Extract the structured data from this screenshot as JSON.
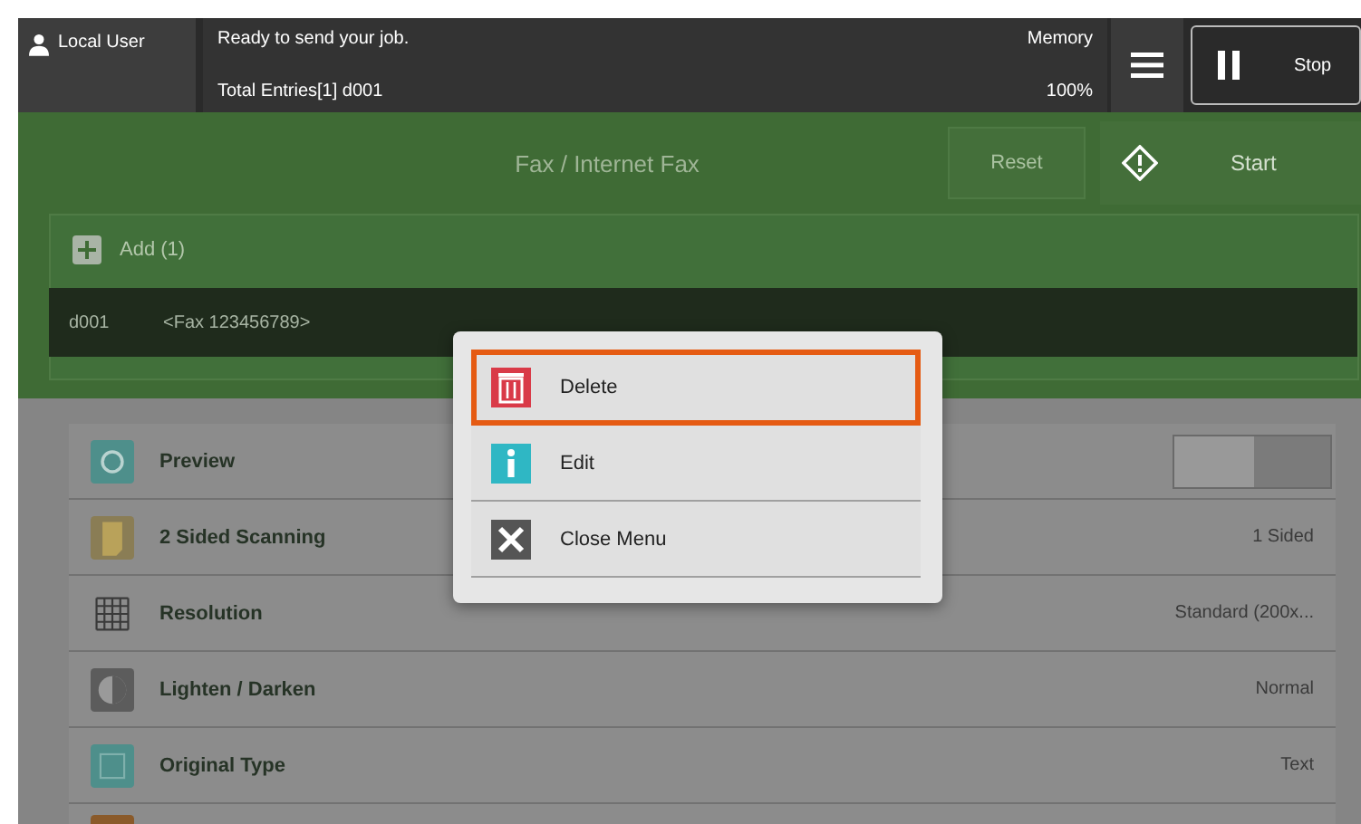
{
  "top_bar": {
    "user": "Local User",
    "status": "Ready to send your job.",
    "total_entries": "Total Entries[1] d001",
    "memory_label": "Memory",
    "memory_value": "100%",
    "stop_label": "Stop"
  },
  "header": {
    "title": "Fax / Internet Fax",
    "reset": "Reset",
    "start": "Start"
  },
  "recipients": {
    "add_label": "Add (1)",
    "entries": [
      {
        "id": "d001",
        "address": "<Fax 123456789>"
      }
    ]
  },
  "features": [
    {
      "kind": "preview",
      "label": "Preview",
      "on": false
    },
    {
      "kind": "sides",
      "label": "2 Sided Scanning",
      "value": "1 Sided"
    },
    {
      "kind": "resolution",
      "label": "Resolution",
      "value": "Standard (200x..."
    },
    {
      "kind": "density",
      "label": "Lighten / Darken",
      "value": "Normal"
    },
    {
      "kind": "original",
      "label": "Original Type",
      "value": "Text"
    }
  ],
  "popup_menu": [
    {
      "kind": "delete",
      "label": "Delete",
      "selected": true
    },
    {
      "kind": "info",
      "label": "Edit",
      "selected": false
    },
    {
      "kind": "close",
      "label": "Close Menu",
      "selected": false
    }
  ]
}
